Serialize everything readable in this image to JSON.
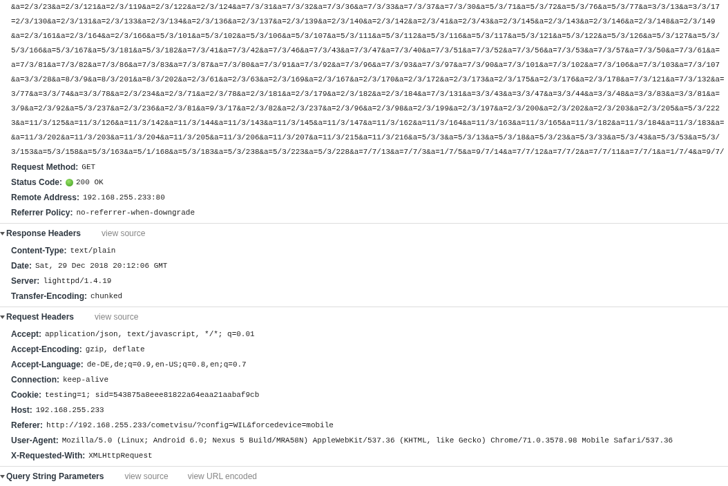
{
  "url_lines": [
    "&a=2/3/23&a=2/3/121&a=2/3/119&a=2/3/122&a=2/3/124&a=7/3/31&a=7/3/32&a=7/3/36&a=7/3/33&a=7/3/37&a=7/3/30&a=5/3/71&a=5/3/72&a=5/3/76&a=5/3/77&a=3/3/13&a=3/3/17",
    "=2/3/130&a=2/3/131&a=2/3/133&a=2/3/134&a=2/3/136&a=2/3/137&a=2/3/139&a=2/3/140&a=2/3/142&a=2/3/41&a=2/3/43&a=2/3/145&a=2/3/143&a=2/3/146&a=2/3/148&a=2/3/149",
    "&a=2/3/161&a=2/3/164&a=2/3/166&a=5/3/101&a=5/3/102&a=5/3/106&a=5/3/107&a=5/3/111&a=5/3/112&a=5/3/116&a=5/3/117&a=5/3/121&a=5/3/122&a=5/3/126&a=5/3/127&a=5/3/",
    "5/3/166&a=5/3/167&a=5/3/181&a=5/3/182&a=7/3/41&a=7/3/42&a=7/3/46&a=7/3/43&a=7/3/47&a=7/3/40&a=7/3/51&a=7/3/52&a=7/3/56&a=7/3/53&a=7/3/57&a=7/3/50&a=7/3/61&a=",
    "a=7/3/81&a=7/3/82&a=7/3/86&a=7/3/83&a=7/3/87&a=7/3/80&a=7/3/91&a=7/3/92&a=7/3/96&a=7/3/93&a=7/3/97&a=7/3/90&a=7/3/101&a=7/3/102&a=7/3/106&a=7/3/103&a=7/3/107",
    "&a=3/3/28&a=8/3/9&a=8/3/201&a=8/3/202&a=2/3/61&a=2/3/63&a=2/3/169&a=2/3/167&a=2/3/170&a=2/3/172&a=2/3/173&a=2/3/175&a=2/3/176&a=2/3/178&a=7/3/121&a=7/3/132&a=",
    "3/77&a=3/3/74&a=3/3/78&a=2/3/234&a=2/3/71&a=2/3/78&a=2/3/181&a=2/3/179&a=2/3/182&a=2/3/184&a=7/3/131&a=3/3/43&a=3/3/47&a=3/3/44&a=3/3/48&a=3/3/83&a=3/3/81&a=",
    "3/9&a=2/3/92&a=5/3/237&a=2/3/236&a=2/3/81&a=9/3/17&a=2/3/82&a=2/3/237&a=2/3/96&a=2/3/98&a=2/3/199&a=2/3/197&a=2/3/200&a=2/3/202&a=2/3/203&a=2/3/205&a=5/3/222",
    "3&a=11/3/125&a=11/3/126&a=11/3/142&a=11/3/144&a=11/3/143&a=11/3/145&a=11/3/147&a=11/3/162&a=11/3/164&a=11/3/163&a=11/3/165&a=11/3/182&a=11/3/184&a=11/3/183&a=",
    "&a=11/3/202&a=11/3/203&a=11/3/204&a=11/3/205&a=11/3/206&a=11/3/207&a=11/3/215&a=11/3/216&a=5/3/3&a=5/3/13&a=5/3/18&a=5/3/23&a=5/3/33&a=5/3/43&a=5/3/53&a=5/3/",
    "3/153&a=5/3/158&a=5/3/163&a=5/1/168&a=5/3/183&a=5/3/238&a=5/3/223&a=5/3/228&a=7/7/13&a=7/7/3&a=1/7/5&a=9/7/14&a=7/7/12&a=7/7/2&a=7/7/11&a=7/7/1&a=1/7/4&a=9/7/"
  ],
  "general": [
    {
      "kind": "plain",
      "label": "Request Method:",
      "value": "GET"
    },
    {
      "kind": "status",
      "label": "Status Code:",
      "value": "200 OK"
    },
    {
      "kind": "plain",
      "label": "Remote Address:",
      "value": "192.168.255.233:80"
    },
    {
      "kind": "plain",
      "label": "Referrer Policy:",
      "value": "no-referrer-when-downgrade"
    }
  ],
  "sections": [
    {
      "title": "Response Headers",
      "expanded": true,
      "links": [
        "view source"
      ],
      "headers": [
        {
          "label": "Content-Type:",
          "value": "text/plain"
        },
        {
          "label": "Date:",
          "value": "Sat, 29 Dec 2018 20:12:06 GMT"
        },
        {
          "label": "Server:",
          "value": "lighttpd/1.4.19"
        },
        {
          "label": "Transfer-Encoding:",
          "value": "chunked"
        }
      ]
    },
    {
      "title": "Request Headers",
      "expanded": true,
      "links": [
        "view source"
      ],
      "headers": [
        {
          "label": "Accept:",
          "value": "application/json, text/javascript, */*; q=0.01"
        },
        {
          "label": "Accept-Encoding:",
          "value": "gzip, deflate"
        },
        {
          "label": "Accept-Language:",
          "value": "de-DE,de;q=0.9,en-US;q=0.8,en;q=0.7"
        },
        {
          "label": "Connection:",
          "value": "keep-alive"
        },
        {
          "label": "Cookie:",
          "value": "testing=1; sid=543875a8eee81822a64eaa21aabaf9cb"
        },
        {
          "label": "Host:",
          "value": "192.168.255.233"
        },
        {
          "label": "Referer:",
          "value": "http://192.168.255.233/cometvisu/?config=WIL&forcedevice=mobile"
        },
        {
          "label": "User-Agent:",
          "value": "Mozilla/5.0 (Linux; Android 6.0; Nexus 5 Build/MRA58N) AppleWebKit/537.36 (KHTML, like Gecko) Chrome/71.0.3578.98 Mobile Safari/537.36"
        },
        {
          "label": "X-Requested-With:",
          "value": "XMLHttpRequest"
        }
      ]
    },
    {
      "title": "Query String Parameters",
      "expanded": true,
      "links": [
        "view source",
        "view URL encoded"
      ]
    }
  ]
}
